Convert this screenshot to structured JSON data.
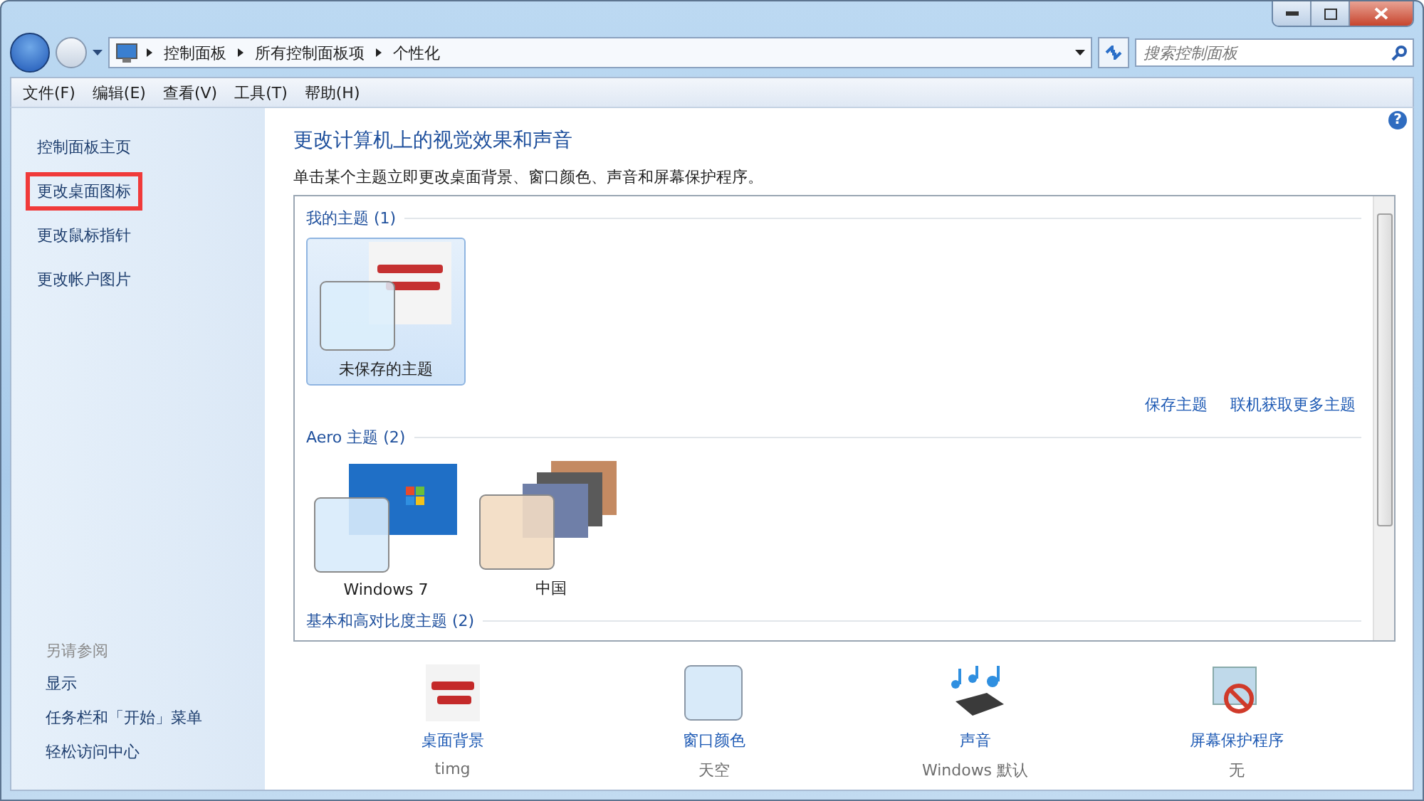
{
  "breadcrumb": [
    "控制面板",
    "所有控制面板项",
    "个性化"
  ],
  "search": {
    "placeholder": "搜索控制面板"
  },
  "menu": [
    "文件(F)",
    "编辑(E)",
    "查看(V)",
    "工具(T)",
    "帮助(H)"
  ],
  "sidebar": {
    "items": [
      {
        "label": "控制面板主页",
        "highlighted": false
      },
      {
        "label": "更改桌面图标",
        "highlighted": true
      },
      {
        "label": "更改鼠标指针",
        "highlighted": false
      },
      {
        "label": "更改帐户图片",
        "highlighted": false
      }
    ],
    "see_also_title": "另请参阅",
    "see_also": [
      "显示",
      "任务栏和「开始」菜单",
      "轻松访问中心"
    ]
  },
  "help": "?",
  "heading": "更改计算机上的视觉效果和声音",
  "description": "单击某个主题立即更改桌面背景、窗口颜色、声音和屏幕保护程序。",
  "theme_groups": [
    {
      "title": "我的主题 (1)",
      "themes": [
        {
          "name": "未保存的主题",
          "kind": "custom",
          "selected": true
        }
      ],
      "links": [
        "保存主题",
        "联机获取更多主题"
      ]
    },
    {
      "title": "Aero 主题 (2)",
      "themes": [
        {
          "name": "Windows 7",
          "kind": "windows",
          "selected": false
        },
        {
          "name": "中国",
          "kind": "slideshow",
          "selected": false
        }
      ]
    },
    {
      "title": "基本和高对比度主题 (2)"
    }
  ],
  "settings": [
    {
      "kind": "background",
      "label": "桌面背景",
      "value": "timg"
    },
    {
      "kind": "color",
      "label": "窗口颜色",
      "value": "天空"
    },
    {
      "kind": "sound",
      "label": "声音",
      "value": "Windows 默认"
    },
    {
      "kind": "screensaver",
      "label": "屏幕保护程序",
      "value": "无"
    }
  ]
}
